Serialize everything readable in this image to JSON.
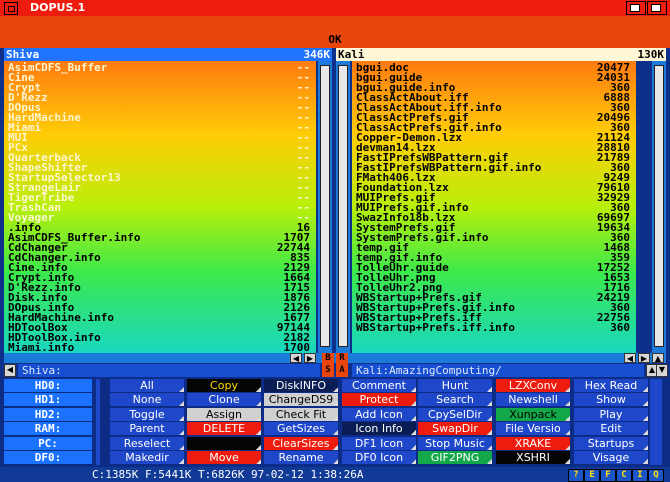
{
  "window": {
    "title": "DOPUS.1",
    "ok_label": "OK"
  },
  "colors": {
    "title_bar": "#ee1c0e",
    "ok_bar": "#e8460c",
    "left_header": "#1f73ff",
    "right_header": "#fdf7d7",
    "bank_bg": "#0d2c86"
  },
  "left": {
    "header_name": "Shiva",
    "header_size": "346K",
    "path": "Shiva:",
    "files": [
      {
        "name": "AsimCDFS_Buffer",
        "size": "--",
        "dir": true
      },
      {
        "name": "Cine",
        "size": "--",
        "dir": true
      },
      {
        "name": "Crypt",
        "size": "--",
        "dir": true
      },
      {
        "name": "D'Rezz",
        "size": "--",
        "dir": true
      },
      {
        "name": "DOpus",
        "size": "--",
        "dir": true
      },
      {
        "name": "HardMachine",
        "size": "--",
        "dir": true
      },
      {
        "name": "Miami",
        "size": "--",
        "dir": true
      },
      {
        "name": "MUI",
        "size": "--",
        "dir": true
      },
      {
        "name": "PCx",
        "size": "--",
        "dir": true
      },
      {
        "name": "Quarterback",
        "size": "--",
        "dir": true
      },
      {
        "name": "ShapeShifter",
        "size": "--",
        "dir": true
      },
      {
        "name": "StartupSelector13",
        "size": "--",
        "dir": true
      },
      {
        "name": "StrangeLair",
        "size": "--",
        "dir": true
      },
      {
        "name": "TigerTribe",
        "size": "--",
        "dir": true
      },
      {
        "name": "TrashCan",
        "size": "--",
        "dir": true
      },
      {
        "name": "Voyager",
        "size": "--",
        "dir": true
      },
      {
        "name": ".info",
        "size": "16",
        "dir": false
      },
      {
        "name": "AsimCDFS_Buffer.info",
        "size": "1707",
        "dir": false
      },
      {
        "name": "CdChanger",
        "size": "22744",
        "dir": false
      },
      {
        "name": "CdChanger.info",
        "size": "835",
        "dir": false
      },
      {
        "name": "Cine.info",
        "size": "2129",
        "dir": false
      },
      {
        "name": "Crypt.info",
        "size": "1664",
        "dir": false
      },
      {
        "name": "D'Rezz.info",
        "size": "1715",
        "dir": false
      },
      {
        "name": "Disk.info",
        "size": "1876",
        "dir": false
      },
      {
        "name": "DOpus.info",
        "size": "2126",
        "dir": false
      },
      {
        "name": "HardMachine.info",
        "size": "1677",
        "dir": false
      },
      {
        "name": "HDToolBox",
        "size": "97144",
        "dir": false
      },
      {
        "name": "HDToolBox.info",
        "size": "2182",
        "dir": false
      },
      {
        "name": "Miami.info",
        "size": "1700",
        "dir": false
      }
    ]
  },
  "right": {
    "header_name": "Kali",
    "header_size": "130K",
    "path": "Kali:AmazingComputing/",
    "files": [
      {
        "name": "bgui.doc",
        "size": "20477"
      },
      {
        "name": "bgui.guide",
        "size": "24031"
      },
      {
        "name": "bgui.guide.info",
        "size": "360"
      },
      {
        "name": "ClassActAbout.iff",
        "size": "6888"
      },
      {
        "name": "ClassActAbout.iff.info",
        "size": "360"
      },
      {
        "name": "ClassActPrefs.gif",
        "size": "20496"
      },
      {
        "name": "ClassActPrefs.gif.info",
        "size": "360"
      },
      {
        "name": "Copper-Demon.lzx",
        "size": "21124"
      },
      {
        "name": "devman14.lzx",
        "size": "28810"
      },
      {
        "name": "FastIPrefsWBPattern.gif",
        "size": "21789"
      },
      {
        "name": "FastIPrefsWBPattern.gif.info",
        "size": "360"
      },
      {
        "name": "FMath406.lzx",
        "size": "9249"
      },
      {
        "name": "Foundation.lzx",
        "size": "79610"
      },
      {
        "name": "MUIPrefs.gif",
        "size": "32929"
      },
      {
        "name": "MUIPrefs.gif.info",
        "size": "360"
      },
      {
        "name": "SwazInfo18b.lzx",
        "size": "69697"
      },
      {
        "name": "SystemPrefs.gif",
        "size": "19634"
      },
      {
        "name": "SystemPrefs.gif.info",
        "size": "360"
      },
      {
        "name": "temp.gif",
        "size": "1468"
      },
      {
        "name": "temp.gif.info",
        "size": "359"
      },
      {
        "name": "TolleUhr.guide",
        "size": "17252"
      },
      {
        "name": "TolleUhr.png",
        "size": "1653"
      },
      {
        "name": "TolleUhr2.png",
        "size": "1716"
      },
      {
        "name": "WBStartup+Prefs.gif",
        "size": "24219"
      },
      {
        "name": "WBStartup+Prefs.gif.info",
        "size": "360"
      },
      {
        "name": "WBStartup+Prefs.iff",
        "size": "22756"
      },
      {
        "name": "WBStartup+Prefs.iff.info",
        "size": "360"
      }
    ]
  },
  "middle_tags": {
    "b": "B",
    "r": "R",
    "s": "S",
    "a": "A"
  },
  "devices": [
    "HD0:",
    "HD1:",
    "HD2:",
    "RAM:",
    "PC:",
    "DF0:"
  ],
  "buttons": [
    [
      {
        "label": "All",
        "bg": "#1f47c9",
        "fg": "#ffffff"
      },
      {
        "label": "None",
        "bg": "#1f47c9",
        "fg": "#ffffff"
      },
      {
        "label": "Toggle",
        "bg": "#1f47c9",
        "fg": "#ffffff"
      },
      {
        "label": "Parent",
        "bg": "#1f47c9",
        "fg": "#ffffff"
      },
      {
        "label": "Reselect",
        "bg": "#1f47c9",
        "fg": "#ffffff"
      },
      {
        "label": "Makedir",
        "bg": "#1f47c9",
        "fg": "#ffffff"
      }
    ],
    [
      {
        "label": "Copy",
        "bg": "#050505",
        "fg": "#ffd800"
      },
      {
        "label": "Clone",
        "bg": "#1f47c9",
        "fg": "#ffffff"
      },
      {
        "label": "Assign",
        "bg": "#d0d0d0",
        "fg": "#000000"
      },
      {
        "label": "DELETE",
        "bg": "#ee1c0e",
        "fg": "#ffffff"
      },
      {
        "label": "",
        "bg": "#050505",
        "fg": "#ffffff"
      },
      {
        "label": "Move",
        "bg": "#ee1c0e",
        "fg": "#ffffff"
      }
    ],
    [
      {
        "label": "DiskINFO",
        "bg": "#0b1d55",
        "fg": "#ffffff"
      },
      {
        "label": "ChangeDS9",
        "bg": "#d0d0d0",
        "fg": "#000000"
      },
      {
        "label": "Check Fit",
        "bg": "#d0d0d0",
        "fg": "#000000"
      },
      {
        "label": "GetSizes",
        "bg": "#1f47c9",
        "fg": "#ffffff"
      },
      {
        "label": "ClearSizes",
        "bg": "#ee1c0e",
        "fg": "#ffffff"
      },
      {
        "label": "Rename",
        "bg": "#1f47c9",
        "fg": "#ffffff"
      }
    ],
    [
      {
        "label": "Comment",
        "bg": "#1f47c9",
        "fg": "#ffffff"
      },
      {
        "label": "Protect",
        "bg": "#ee1c0e",
        "fg": "#ffffff"
      },
      {
        "label": "Add Icon",
        "bg": "#1f47c9",
        "fg": "#ffffff"
      },
      {
        "label": "Icon Info",
        "bg": "#0b1d55",
        "fg": "#ffffff"
      },
      {
        "label": "DF1 Icon",
        "bg": "#1f47c9",
        "fg": "#ffffff"
      },
      {
        "label": "DF0 Icon",
        "bg": "#1f47c9",
        "fg": "#ffffff"
      }
    ],
    [
      {
        "label": "Hunt",
        "bg": "#1f47c9",
        "fg": "#ffffff"
      },
      {
        "label": "Search",
        "bg": "#1f47c9",
        "fg": "#ffffff"
      },
      {
        "label": "CpySelDir",
        "bg": "#1f47c9",
        "fg": "#ffffff"
      },
      {
        "label": "SwapDir",
        "bg": "#ee1c0e",
        "fg": "#ffffff"
      },
      {
        "label": "Stop Music",
        "bg": "#1f47c9",
        "fg": "#ffffff"
      },
      {
        "label": "GIF2PNG",
        "bg": "#13a84a",
        "fg": "#ffffff"
      }
    ],
    [
      {
        "label": "LZXConv",
        "bg": "#ee1c0e",
        "fg": "#ffffff"
      },
      {
        "label": "Newshell",
        "bg": "#1f47c9",
        "fg": "#ffffff"
      },
      {
        "label": "Xunpack",
        "bg": "#13a84a",
        "fg": "#000000"
      },
      {
        "label": "File Versio",
        "bg": "#1f47c9",
        "fg": "#ffffff"
      },
      {
        "label": "XRAKE",
        "bg": "#ee1c0e",
        "fg": "#ffffff"
      },
      {
        "label": "XSHRI",
        "bg": "#050505",
        "fg": "#ffffff"
      }
    ],
    [
      {
        "label": "Hex Read",
        "bg": "#1f47c9",
        "fg": "#ffffff"
      },
      {
        "label": "Show",
        "bg": "#1f47c9",
        "fg": "#ffffff"
      },
      {
        "label": "Play",
        "bg": "#1f47c9",
        "fg": "#ffffff"
      },
      {
        "label": "Edit",
        "bg": "#1f47c9",
        "fg": "#ffffff"
      },
      {
        "label": "Startups",
        "bg": "#1f47c9",
        "fg": "#ffffff"
      },
      {
        "label": "Visage",
        "bg": "#1f47c9",
        "fg": "#ffffff"
      }
    ]
  ],
  "status": {
    "text": "C:1385K  F:5441K  T:6826K  97-02-12  1:38:26A",
    "boxes": [
      "?",
      "E",
      "F",
      "C",
      "I",
      "Q"
    ]
  }
}
